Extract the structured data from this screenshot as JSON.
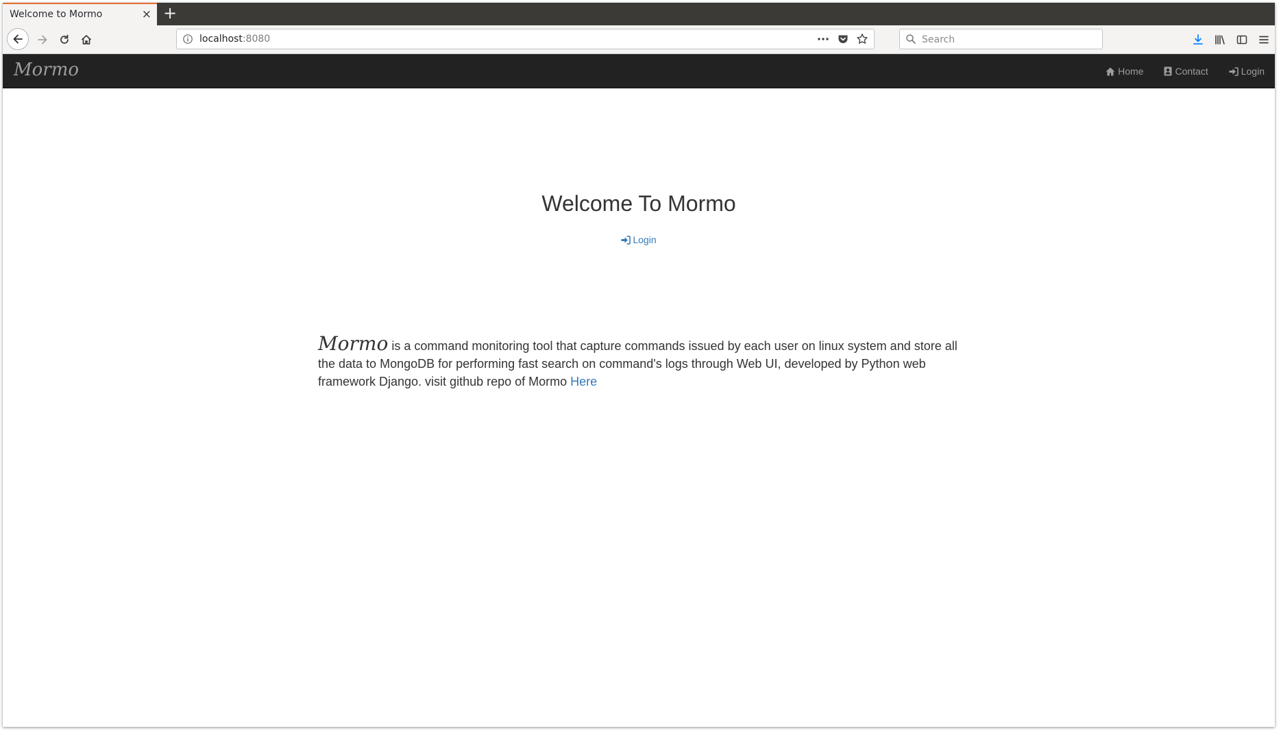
{
  "browser": {
    "tab_title": "Welcome to Mormo",
    "tab_close": "×",
    "new_tab": "+",
    "url_host": "localhost",
    "url_port": ":8080",
    "search_placeholder": "Search"
  },
  "navbar": {
    "brand": "Mormo",
    "links": [
      {
        "label": "Home",
        "icon": "home-icon"
      },
      {
        "label": "Contact",
        "icon": "contact-icon"
      },
      {
        "label": "Login",
        "icon": "sign-in-icon"
      }
    ]
  },
  "main": {
    "heading": "Welcome To Mormo",
    "login_label": "Login",
    "description": {
      "brand": "Mormo",
      "text": " is a command monitoring tool that capture commands issued by each user on linux system and store all the data to MongoDB for performing fast search on command's logs through Web UI, developed by Python web framework Django. visit github repo of Mormo ",
      "link_label": "Here"
    }
  },
  "colors": {
    "navbar_bg": "#222222",
    "navbar_text": "#9d9d9d",
    "link": "#337ab7",
    "text": "#333333",
    "tab_accent": "#e66c2c"
  }
}
